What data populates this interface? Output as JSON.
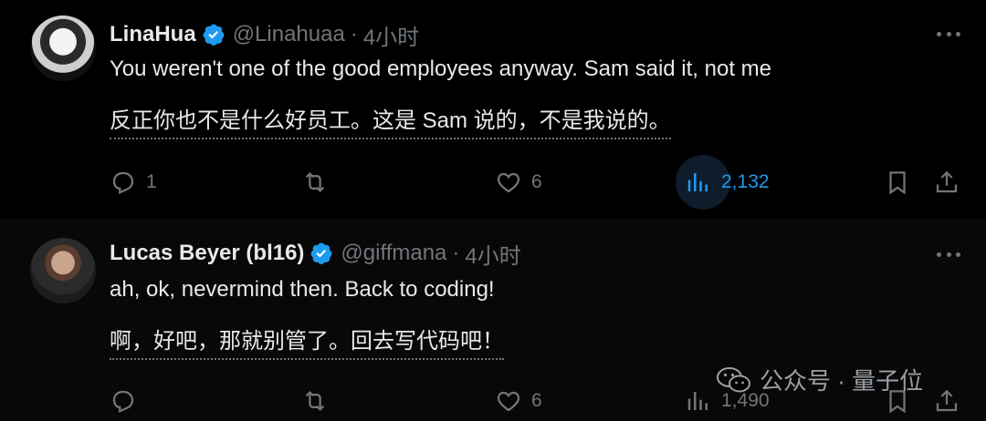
{
  "tweets": [
    {
      "name": "LinaHua",
      "handle": "@Linahuaa",
      "separator": "·",
      "time": "4小时",
      "text_en": "You weren't one of the good employees anyway. Sam said it, not me",
      "text_zh": "反正你也不是什么好员工。这是 Sam 说的，不是我说的。",
      "replies": "1",
      "retweets": "",
      "likes": "6",
      "views": "2,132"
    },
    {
      "name": "Lucas Beyer (bl16)",
      "handle": "@giffmana",
      "separator": "·",
      "time": "4小时",
      "text_en": "ah, ok, nevermind then. Back to coding!",
      "text_zh": "啊，好吧，那就别管了。回去写代码吧！",
      "replies": "",
      "retweets": "",
      "likes": "6",
      "views": "1,490"
    }
  ],
  "watermark": {
    "text": "公众号 · 量子位"
  },
  "colors": {
    "accent": "#1d9bf0",
    "muted": "#71767b",
    "text": "#e7e9ea",
    "background": "#000000"
  }
}
